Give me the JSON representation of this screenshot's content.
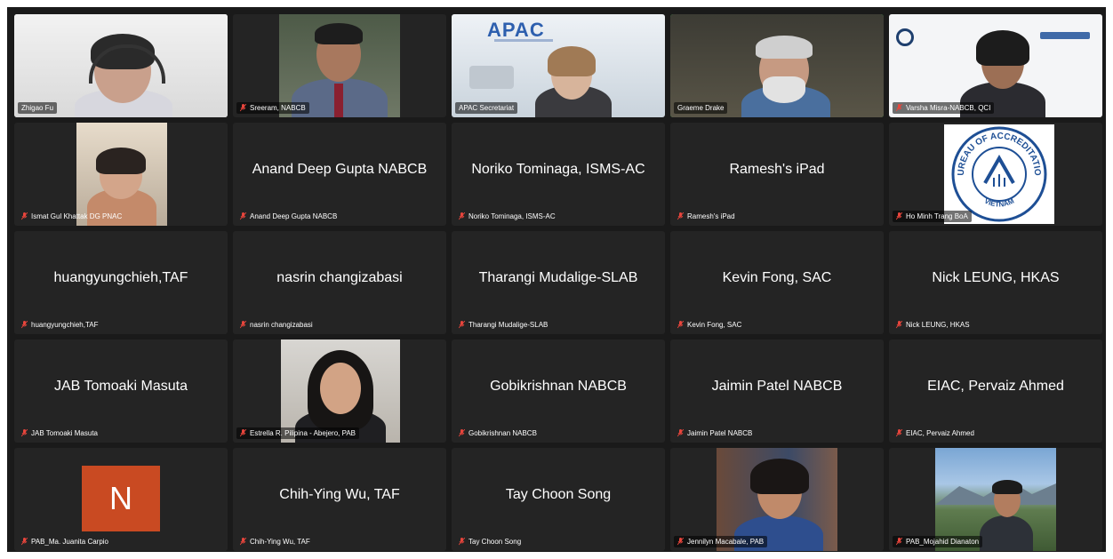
{
  "meeting": {
    "participants": [
      {
        "label": "Zhigao Fu",
        "center": "",
        "muted": false,
        "active": false
      },
      {
        "label": "Sreeram, NABCB",
        "center": "",
        "muted": true,
        "active": false
      },
      {
        "label": "APAC Secretariat",
        "center": "",
        "muted": false,
        "active": false,
        "logo": "APAC"
      },
      {
        "label": "Graeme Drake",
        "center": "",
        "muted": false,
        "active": true
      },
      {
        "label": "Varsha Misra-NABCB, QCI",
        "center": "",
        "muted": true,
        "active": false
      },
      {
        "label": "Ismat Gul Khattak DG PNAC",
        "center": "",
        "muted": true,
        "active": false
      },
      {
        "label": "Anand Deep Gupta NABCB",
        "center": "Anand Deep Gupta NABCB",
        "muted": true,
        "active": false
      },
      {
        "label": "Noriko Tominaga, ISMS-AC",
        "center": "Noriko Tominaga, ISMS-AC",
        "muted": true,
        "active": false
      },
      {
        "label": "Ramesh's iPad",
        "center": "Ramesh's iPad",
        "muted": true,
        "active": false
      },
      {
        "label": "Ho Minh Trang BoA",
        "center": "",
        "muted": true,
        "active": false,
        "seal": {
          "top": "BUREAU OF ACCREDITATION",
          "bottom": "VIETNAM"
        }
      },
      {
        "label": "huangyungchieh,TAF",
        "center": "huangyungchieh,TAF",
        "muted": true,
        "active": false
      },
      {
        "label": "nasrin changizabasi",
        "center": "nasrin changizabasi",
        "muted": true,
        "active": false
      },
      {
        "label": "Tharangi Mudalige-SLAB",
        "center": "Tharangi Mudalige-SLAB",
        "muted": true,
        "active": false
      },
      {
        "label": "Kevin Fong, SAC",
        "center": "Kevin Fong, SAC",
        "muted": true,
        "active": false
      },
      {
        "label": "Nick LEUNG, HKAS",
        "center": "Nick LEUNG, HKAS",
        "muted": true,
        "active": false
      },
      {
        "label": "JAB Tomoaki Masuta",
        "center": "JAB Tomoaki Masuta",
        "muted": true,
        "active": false
      },
      {
        "label": "Estrella R. Pilipina - Abejero, PAB",
        "center": "",
        "muted": true,
        "active": false
      },
      {
        "label": "Gobikrishnan NABCB",
        "center": "Gobikrishnan NABCB",
        "muted": true,
        "active": false
      },
      {
        "label": "Jaimin Patel NABCB",
        "center": "Jaimin Patel NABCB",
        "muted": true,
        "active": false
      },
      {
        "label": "EIAC, Pervaiz Ahmed",
        "center": "EIAC, Pervaiz Ahmed",
        "muted": true,
        "active": false
      },
      {
        "label": "PAB_Ma. Juanita Carpio",
        "center": "",
        "muted": true,
        "active": false,
        "initial": "N"
      },
      {
        "label": "Chih-Ying Wu, TAF",
        "center": "Chih-Ying Wu, TAF",
        "muted": true,
        "active": false
      },
      {
        "label": "Tay Choon Song",
        "center": "Tay Choon Song",
        "muted": true,
        "active": false
      },
      {
        "label": "Jennilyn Macabale, PAB",
        "center": "",
        "muted": true,
        "active": false
      },
      {
        "label": "PAB_Mojahid Dianaton",
        "center": "",
        "muted": true,
        "active": false
      }
    ]
  },
  "colors": {
    "background": "#1a1a1a",
    "tile": "#242424",
    "active_speaker": "#2bd34c",
    "muted_icon": "#e8453c",
    "initial_avatar": "#c94a22"
  }
}
